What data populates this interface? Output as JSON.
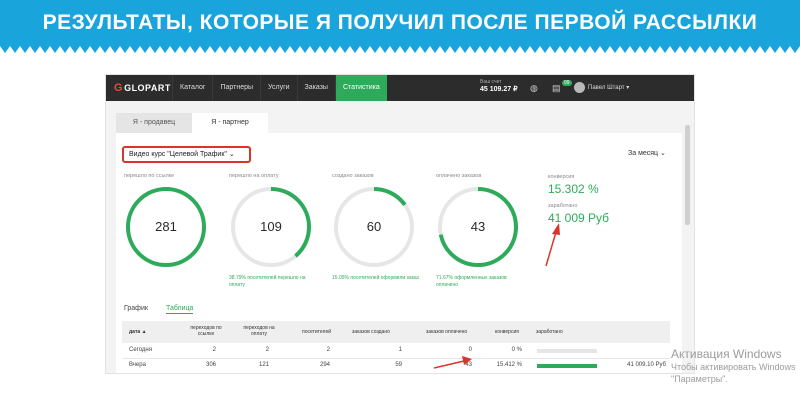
{
  "banner": {
    "title": "РЕЗУЛЬТАТЫ, КОТОРЫЕ Я ПОЛУЧИЛ ПОСЛЕ ПЕРВОЙ РАССЫЛКИ"
  },
  "navbar": {
    "logo": "GLOPART",
    "items": [
      "Каталог",
      "Партнеры",
      "Услуги",
      "Заказы",
      "Статистика"
    ],
    "active_index": 4,
    "balance_label": "Ваш счет",
    "balance_value": "45 109.27 ₽",
    "notification_count": "99",
    "user_name": "Павел Штарт"
  },
  "tabs": [
    "Я - продавец",
    "Я - партнер"
  ],
  "filters": {
    "course": "Видео курс \"Целевой Трафик\"",
    "period": "За месяц"
  },
  "stats": [
    {
      "label": "перешло по ссылке",
      "value": "281",
      "percent": 100,
      "note": ""
    },
    {
      "label": "перешло на оплату",
      "value": "109",
      "percent": 38.79,
      "note": "38.79% посетителей перешло на оплату"
    },
    {
      "label": "создано заказов",
      "value": "60",
      "percent": 15.05,
      "note": "15.05% посетителей оформили заказ"
    },
    {
      "label": "оплачено заказов",
      "value": "43",
      "percent": 71.67,
      "note": "71.67% оформленных заказов оплачено"
    }
  ],
  "conversion": {
    "label": "конверсия",
    "value": "15.302 %"
  },
  "earned": {
    "label": "заработано",
    "value": "41 009 Руб"
  },
  "views": [
    "График",
    "Таблица"
  ],
  "table": {
    "headers": [
      "дата ▲",
      "переходов по ссылке",
      "переходов на оплату",
      "посетителей",
      "заказов создано",
      "заказов оплачено",
      "конверсия",
      "заработано"
    ],
    "rows": [
      {
        "date": "Сегодня",
        "clicks": "2",
        "to_pay": "2",
        "visitors": "2",
        "created": "1",
        "paid": "0",
        "conversion": "0 %",
        "progress": 0,
        "earned": ""
      },
      {
        "date": "Вчера",
        "clicks": "306",
        "to_pay": "121",
        "visitors": "294",
        "created": "59",
        "paid": "43",
        "conversion": "15.412 %",
        "progress": 100,
        "earned": "41 009.10 Руб"
      }
    ]
  },
  "watermark": {
    "line1": "Активация Windows",
    "line2": "Чтобы активировать Windows",
    "line3": "\"Параметры\"."
  },
  "colors": {
    "banner": "#1aa4dc",
    "accent": "#2eab5a",
    "highlight": "#d9362b",
    "navbar": "#2c2c2c"
  }
}
